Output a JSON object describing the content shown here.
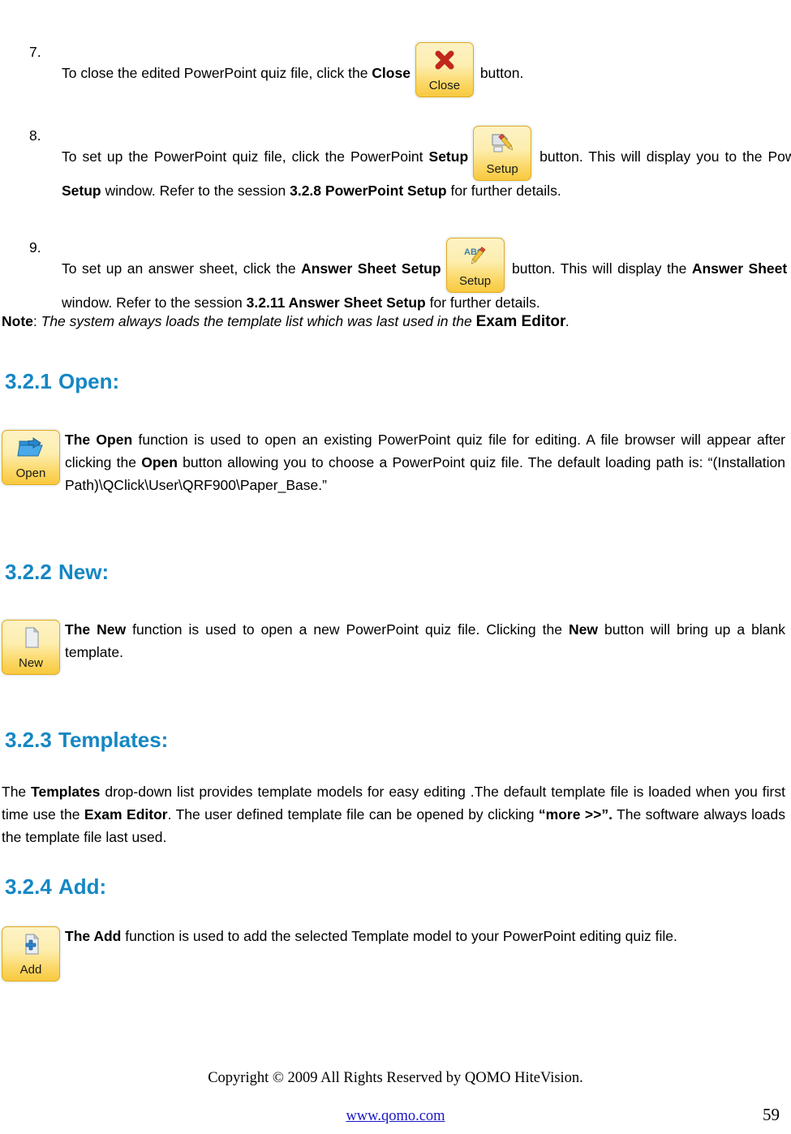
{
  "document": {
    "list_items": [
      {
        "number": "7.",
        "segments": [
          {
            "t": "To close the edited PowerPoint quiz file, click the ",
            "b": false
          },
          {
            "t": "Close",
            "b": true
          }
        ],
        "tail": " button.",
        "button": {
          "name": "close-button",
          "caption": "Close",
          "icon": "red-x-icon"
        }
      },
      {
        "number": "8.",
        "segments": [
          {
            "t": "To set up the PowerPoint quiz file, click the PowerPoint ",
            "b": false
          },
          {
            "t": "Setup",
            "b": true
          }
        ],
        "tail_parts": [
          {
            "t": " button. This will display you to the PowerPoint ",
            "b": false
          },
          {
            "t": "Setup",
            "b": true
          },
          {
            "t": " window. Refer to the session ",
            "b": false
          },
          {
            "t": "3.2.8 PowerPoint Setup",
            "b": true
          },
          {
            "t": " for further details.",
            "b": false
          }
        ],
        "button": {
          "name": "powerpoint-setup-button",
          "caption": "Setup",
          "icon": "document-pencil-icon"
        }
      },
      {
        "number": "9.",
        "segments": [
          {
            "t": "To set up an answer sheet, click the ",
            "b": false
          },
          {
            "t": "Answer Sheet Setup",
            "b": true
          }
        ],
        "tail_parts": [
          {
            "t": " button. This will display the ",
            "b": false
          },
          {
            "t": "Answer Sheet Setting",
            "b": true
          },
          {
            "t": " window. Refer to the session ",
            "b": false
          },
          {
            "t": "3.2.11 Answer Sheet Setup",
            "b": true
          },
          {
            "t": " for further details.",
            "b": false
          }
        ],
        "button": {
          "name": "answer-sheet-setup-button",
          "caption": "Setup",
          "icon": "abc-pencil-icon"
        }
      }
    ],
    "note": {
      "label": "Note",
      "colon": ": ",
      "text_before": "The system always loads the template list which was last used in the ",
      "emphasis": "Exam Editor",
      "text_after": "."
    },
    "sections": [
      {
        "num": "3.2.1",
        "title": "Open:",
        "button": {
          "name": "open-button",
          "caption": "Open",
          "icon": "open-folder-icon"
        },
        "paragraph": [
          {
            "t": "The Open",
            "b": true
          },
          {
            "t": " function is used to open an existing PowerPoint quiz file for editing. A file browser will appear after clicking the ",
            "b": false
          },
          {
            "t": "Open",
            "b": true
          },
          {
            "t": " button allowing you to choose a PowerPoint quiz file. The default loading path is: “(Installation Path)\\QClick\\User\\QRF900\\Paper_Base.”",
            "b": false
          }
        ]
      },
      {
        "num": "3.2.2",
        "title": "New:",
        "button": {
          "name": "new-button",
          "caption": "New",
          "icon": "blank-page-icon"
        },
        "paragraph": [
          {
            "t": "The New",
            "b": true
          },
          {
            "t": " function is used to open a new PowerPoint quiz file. Clicking the ",
            "b": false
          },
          {
            "t": "New",
            "b": true
          },
          {
            "t": " button will bring up a blank template.",
            "b": false
          }
        ]
      },
      {
        "num": "3.2.3",
        "title": "Templates:",
        "button": null,
        "paragraph": [
          {
            "t": "The ",
            "b": false
          },
          {
            "t": "Templates",
            "b": true
          },
          {
            "t": " drop-down list provides template models for easy editing .The default template file is loaded when you first time use the ",
            "b": false
          },
          {
            "t": "Exam Editor",
            "b": true
          },
          {
            "t": ". The user defined template file can be opened by clicking ",
            "b": false
          },
          {
            "t": "“more >>”.",
            "b": true
          },
          {
            "t": " The software always loads the template file last used.",
            "b": false
          }
        ]
      },
      {
        "num": "3.2.4",
        "title": "Add:",
        "button": {
          "name": "add-button",
          "caption": "Add",
          "icon": "add-page-icon"
        },
        "paragraph": [
          {
            "t": "The Add",
            "b": true
          },
          {
            "t": " function is used to add the selected Template model to your PowerPoint editing quiz file.",
            "b": false
          }
        ]
      }
    ],
    "footer": {
      "copyright": "Copyright © 2009 All Rights Reserved by QOMO HiteVision.",
      "website": "www.qomo.com",
      "page_number": "59"
    },
    "colors": {
      "heading_blue": "#1587C4",
      "link_blue": "#1A16C8",
      "button_gold": "#F8C93F",
      "button_border": "#E3A81F",
      "close_icon_red": "#C0281C"
    }
  }
}
